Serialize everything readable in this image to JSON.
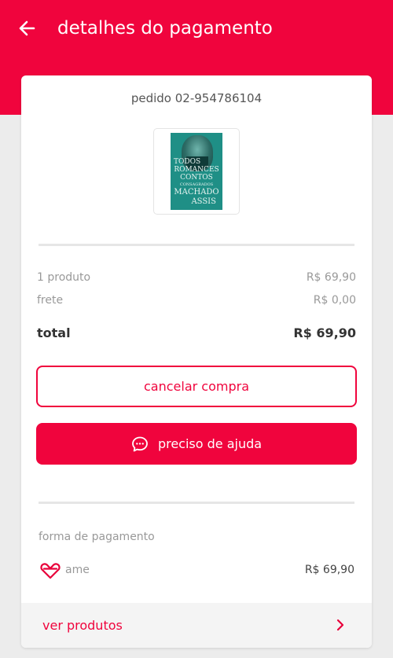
{
  "header": {
    "title": "detalhes do pagamento",
    "back_icon": "arrow-left-icon",
    "color": "#f0043d"
  },
  "order": {
    "id_label": "pedido 02-954786104"
  },
  "product": {
    "cover_lines": [
      "TODOS",
      "ROMANCES",
      "CONTOS",
      "CONSAGRADOS",
      "MACHADO",
      "ASSIS"
    ],
    "cover_color": "#1f8f86"
  },
  "summary": {
    "items_label": "1 produto",
    "items_value": "R$ 69,90",
    "shipping_label": "frete",
    "shipping_value": "R$ 0,00",
    "total_label": "total",
    "total_value": "R$ 69,90"
  },
  "actions": {
    "cancel_label": "cancelar compra",
    "help_label": "preciso de ajuda",
    "help_icon": "chat-bubble-icon"
  },
  "payment": {
    "title": "forma de pagamento",
    "method": "ame",
    "method_icon": "ame-heart-icon",
    "amount": "R$ 69,90"
  },
  "footer": {
    "see_products_label": "ver produtos",
    "chevron_icon": "chevron-right-icon"
  }
}
